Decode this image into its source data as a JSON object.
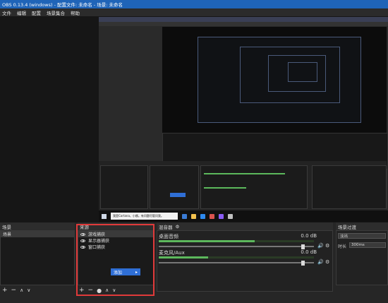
{
  "window": {
    "title": "OBS 0.13.4 (windows) - 配置文件: 未命名 - 场景: 未命名"
  },
  "menu": [
    "文件",
    "编辑",
    "配置",
    "场景集合",
    "帮助"
  ],
  "scenes": {
    "title": "场景",
    "items": [
      "场景"
    ]
  },
  "sources": {
    "title": "来源",
    "items": [
      {
        "label": "游戏捕获",
        "selected": true
      },
      {
        "label": "显示器捕获",
        "selected": false
      },
      {
        "label": "窗口捕获",
        "selected": false
      }
    ],
    "add_button": "添加"
  },
  "mixer": {
    "title": "混音器",
    "channels": [
      {
        "name": "桌面音频",
        "db": "0.0 dB",
        "level": 0.62,
        "volume": 0.93
      },
      {
        "name": "麦克风/Aux",
        "db": "0.0 dB",
        "level": 0.32,
        "volume": 0.93
      }
    ]
  },
  "transitions": {
    "title": "场景过渡",
    "select_value": "淡出",
    "duration_label": "时长",
    "duration_value": "300ms"
  },
  "taskbar": {
    "search_placeholder": "我是Cortana，小娜。有问题尽管问我。"
  },
  "colors": {
    "accent": "#2f6fd6",
    "highlight": "#e03a3a",
    "titlebar": "#1f64b8",
    "meter": "#5cb85c"
  }
}
